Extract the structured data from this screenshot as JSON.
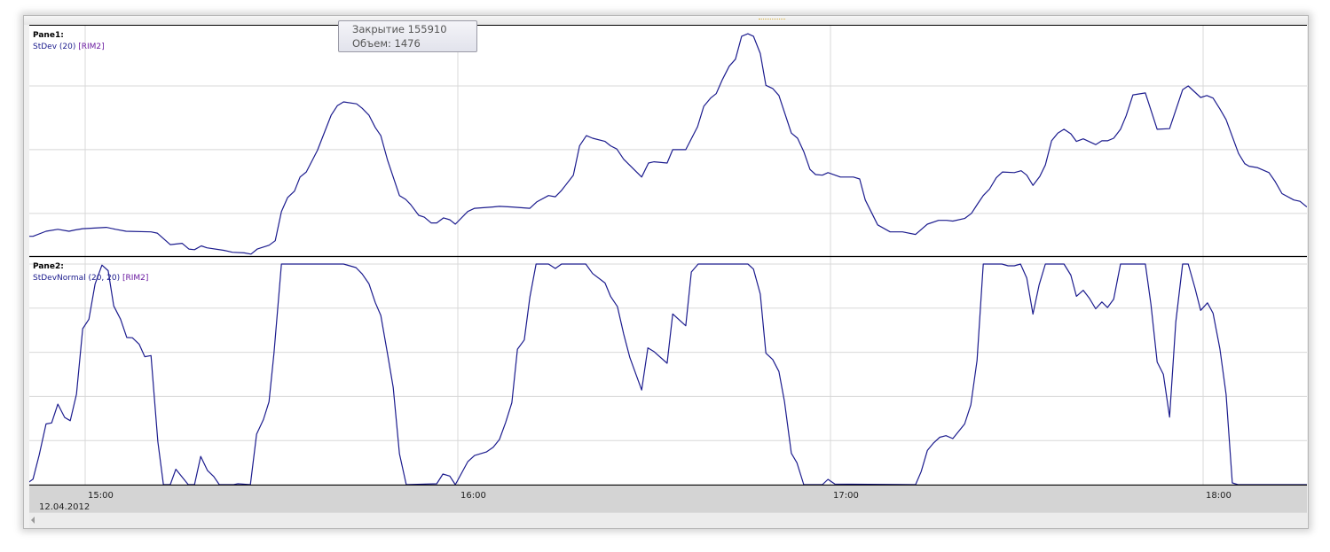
{
  "tooltip": {
    "close_line": "Закрытие 155910",
    "volume_line": "Объем: 1476"
  },
  "colors": {
    "series": "#1c1c8e",
    "grid": "#d8d8d8",
    "axis_band": "#d4d4d4"
  },
  "chart_data": [
    {
      "type": "line",
      "pane_title": "Pane1:",
      "series_label": "StDev (20)",
      "symbol": "[RIM2]",
      "x_unit": "minutes after 15:00",
      "ylim": [
        0.33,
        3.96
      ],
      "grid": true,
      "x": [
        -9.4,
        -8.4,
        -6.3,
        -4.4,
        -2.6,
        -1.6,
        -0.4,
        3.4,
        4.9,
        6.6,
        10.6,
        11.6,
        13.7,
        15.6,
        16.7,
        17.6,
        18.7,
        19.6,
        22.3,
        23.7,
        25.6,
        26.7,
        27.7,
        29.6,
        30.6,
        31.6,
        32.6,
        33.7,
        34.6,
        35.6,
        37.4,
        39.6,
        40.6,
        41.6,
        43.7,
        44.6,
        45.7,
        46.7,
        47.6,
        48.7,
        50.6,
        51.6,
        52.4,
        53.7,
        54.6,
        55.7,
        56.6,
        57.7,
        58.7,
        59.6,
        61.6,
        62.7,
        65.6,
        66.7,
        68.7,
        71.6,
        72.7,
        74.6,
        75.7,
        76.7,
        78.6,
        79.6,
        80.7,
        81.7,
        83.7,
        84.6,
        85.6,
        86.7,
        89.6,
        90.7,
        91.6,
        93.7,
        94.6,
        96.7,
        98.6,
        99.6,
        100.7,
        101.6,
        102.6,
        103.7,
        104.7,
        105.7,
        106.7,
        107.6,
        108.7,
        109.6,
        110.7,
        111.7,
        113.7,
        114.7,
        115.7,
        116.7,
        117.6,
        118.7,
        119.6,
        121.6,
        123.7,
        124.7,
        125.6,
        127.6,
        129.6,
        131.6,
        133.7,
        135.6,
        137.4,
        138.7,
        139.7,
        141.6,
        142.7,
        143.7,
        144.6,
        145.6,
        146.7,
        147.7,
        149.6,
        150.7,
        151.6,
        152.6,
        153.7,
        154.6,
        155.6,
        156.6,
        157.6,
        158.7,
        159.6,
        160.7,
        162.7,
        163.7,
        164.6,
        165.6,
        166.7,
        167.6,
        168.7,
        170.7,
        172.6,
        174.6,
        176.7,
        177.6,
        179.6,
        180.6,
        181.6,
        182.7,
        183.7,
        185.7,
        186.7,
        187.4,
        188.7,
        190.6,
        191.6,
        192.7,
        194.6,
        195.6,
        196.7
      ],
      "y": [
        0.64,
        0.64,
        0.72,
        0.75,
        0.72,
        0.74,
        0.76,
        0.78,
        0.75,
        0.72,
        0.71,
        0.69,
        0.51,
        0.53,
        0.44,
        0.43,
        0.49,
        0.46,
        0.42,
        0.39,
        0.38,
        0.36,
        0.44,
        0.5,
        0.57,
        1.03,
        1.25,
        1.35,
        1.57,
        1.65,
        1.99,
        2.54,
        2.69,
        2.75,
        2.72,
        2.65,
        2.54,
        2.35,
        2.22,
        1.83,
        1.28,
        1.22,
        1.14,
        0.97,
        0.94,
        0.85,
        0.85,
        0.93,
        0.9,
        0.83,
        1.03,
        1.08,
        1.1,
        1.11,
        1.1,
        1.08,
        1.18,
        1.28,
        1.26,
        1.36,
        1.6,
        2.06,
        2.22,
        2.18,
        2.13,
        2.06,
        2.01,
        1.85,
        1.57,
        1.79,
        1.81,
        1.79,
        2.0,
        2.0,
        2.36,
        2.68,
        2.81,
        2.88,
        3.1,
        3.31,
        3.42,
        3.78,
        3.82,
        3.78,
        3.51,
        3.01,
        2.96,
        2.85,
        2.26,
        2.18,
        1.97,
        1.69,
        1.61,
        1.6,
        1.64,
        1.57,
        1.57,
        1.54,
        1.21,
        0.82,
        0.71,
        0.71,
        0.67,
        0.83,
        0.89,
        0.89,
        0.88,
        0.92,
        1.0,
        1.15,
        1.28,
        1.38,
        1.56,
        1.65,
        1.64,
        1.67,
        1.6,
        1.44,
        1.58,
        1.76,
        2.14,
        2.26,
        2.32,
        2.25,
        2.13,
        2.17,
        2.08,
        2.14,
        2.14,
        2.18,
        2.32,
        2.53,
        2.86,
        2.89,
        2.32,
        2.33,
        2.94,
        3.0,
        2.82,
        2.85,
        2.81,
        2.64,
        2.47,
        1.94,
        1.78,
        1.74,
        1.72,
        1.64,
        1.5,
        1.31,
        1.21,
        1.19,
        1.1
      ],
      "y_gridlines": [
        1,
        2,
        3
      ]
    },
    {
      "type": "line",
      "pane_title": "Pane2:",
      "series_label": "StDevNormal (20, 20)",
      "symbol": "[RIM2]",
      "x_unit": "minutes after 15:00",
      "ylim": [
        0,
        100
      ],
      "grid": true,
      "x": [
        -9.4,
        -8.4,
        -7.4,
        -6.3,
        -5.4,
        -4.4,
        -3.3,
        -2.4,
        -1.4,
        -0.4,
        0.6,
        1.6,
        2.7,
        3.7,
        4.6,
        5.7,
        6.7,
        7.6,
        8.7,
        9.6,
        10.6,
        11.7,
        12.6,
        13.7,
        14.6,
        16.6,
        17.6,
        18.6,
        19.7,
        20.7,
        21.6,
        23.9,
        24.6,
        26.6,
        27.6,
        28.7,
        29.6,
        30.4,
        31.6,
        41.6,
        43.6,
        44.6,
        45.7,
        46.7,
        47.6,
        48.7,
        49.6,
        50.6,
        51.7,
        56.6,
        57.6,
        58.7,
        59.6,
        61.6,
        62.7,
        64.6,
        65.7,
        66.7,
        67.7,
        68.7,
        69.6,
        70.7,
        71.6,
        72.6,
        74.6,
        75.7,
        76.7,
        80.6,
        81.7,
        83.7,
        84.6,
        85.7,
        86.7,
        87.7,
        89.6,
        90.6,
        91.6,
        93.7,
        94.6,
        96.7,
        97.6,
        98.7,
        106.7,
        107.6,
        108.7,
        109.6,
        110.7,
        111.7,
        112.6,
        113.7,
        114.6,
        115.7,
        118.7,
        119.6,
        120.7,
        133.7,
        134.6,
        135.6,
        136.6,
        137.6,
        138.6,
        139.7,
        141.6,
        142.6,
        143.6,
        144.6,
        147.6,
        148.6,
        149.6,
        150.6,
        151.6,
        152.6,
        153.6,
        154.6,
        157.6,
        158.7,
        159.6,
        160.7,
        161.7,
        162.7,
        163.7,
        164.6,
        165.6,
        166.7,
        170.7,
        171.6,
        172.6,
        173.6,
        174.6,
        175.6,
        176.7,
        177.6,
        178.7,
        179.6,
        180.7,
        181.6,
        182.7,
        183.7,
        184.7,
        185.6,
        196.7
      ],
      "y": [
        0.5,
        2.5,
        13.5,
        27.5,
        28,
        36.5,
        30.5,
        29,
        41,
        70.7,
        75,
        91,
        99.5,
        97,
        81,
        75,
        66.7,
        66.6,
        63.6,
        58,
        58.5,
        19.5,
        0,
        0,
        7,
        0,
        0,
        12.8,
        6.4,
        3.7,
        0,
        0,
        0.4,
        0,
        22.9,
        29.5,
        37.6,
        59.6,
        100,
        100,
        98.4,
        95.5,
        91,
        82.6,
        76.7,
        59,
        44,
        14,
        0,
        0.4,
        4.8,
        3.9,
        0,
        10.4,
        13.2,
        14.8,
        17,
        20.5,
        28.2,
        37.2,
        61.4,
        65.6,
        85,
        100,
        100,
        98,
        100,
        100,
        95.7,
        91.4,
        85.3,
        80.7,
        68.3,
        57.6,
        42.9,
        62,
        60.3,
        55,
        77.4,
        72,
        96.4,
        100,
        100,
        97.7,
        86.4,
        59.6,
        56.7,
        51.3,
        37.6,
        14.2,
        9.9,
        0,
        0,
        2.4,
        0.3,
        0,
        5.9,
        15.5,
        18.9,
        21.5,
        22.2,
        20.9,
        27.5,
        36.2,
        56.3,
        100,
        100,
        99.2,
        99.2,
        100,
        93.7,
        77.3,
        90.6,
        100,
        100,
        95,
        85.4,
        88.1,
        84.4,
        79.7,
        82.8,
        80.3,
        84.1,
        100,
        100,
        81.7,
        55.6,
        50,
        30.6,
        73.7,
        100,
        100,
        89,
        79,
        82.4,
        77.7,
        61.6,
        40.9,
        0.8,
        0,
        0
      ],
      "y_gridlines": [
        20,
        40,
        60,
        80,
        100
      ]
    }
  ],
  "x_axis": {
    "ticks": [
      {
        "minutes": 0,
        "label": "15:00"
      },
      {
        "minutes": 60,
        "label": "16:00"
      },
      {
        "minutes": 120,
        "label": "17:00"
      },
      {
        "minutes": 180,
        "label": "18:00"
      }
    ],
    "date_label": "12.04.2012"
  }
}
